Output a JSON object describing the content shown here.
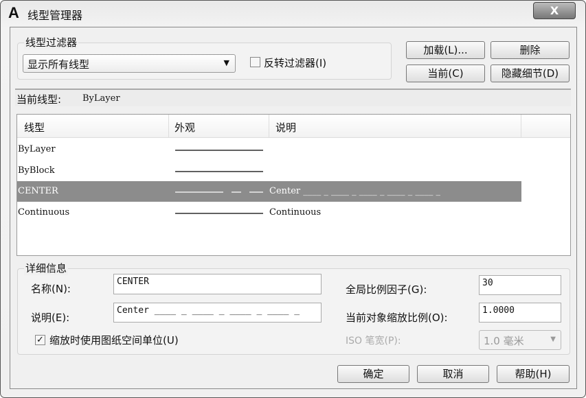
{
  "window": {
    "title": "线型管理器",
    "close_label": "X"
  },
  "filter": {
    "group_label": "线型过滤器",
    "selected": "显示所有线型",
    "invert_label": "反转过滤器(I)",
    "invert_checked": false
  },
  "buttons": {
    "load": "加载(L)...",
    "delete": "删除",
    "current": "当前(C)",
    "hide_details": "隐藏细节(D)"
  },
  "current_linetype": {
    "label": "当前线型:",
    "value": "ByLayer"
  },
  "list": {
    "columns": [
      "线型",
      "外观",
      "说明"
    ],
    "rows": [
      {
        "name": "ByLayer",
        "appearance": "solid",
        "description": "",
        "selected": false
      },
      {
        "name": "ByBlock",
        "appearance": "solid",
        "description": "",
        "selected": false
      },
      {
        "name": "CENTER",
        "appearance": "center",
        "description": "Center ____ _ ____ _ ____ _ ____ _ ____ _",
        "selected": true
      },
      {
        "name": "Continuous",
        "appearance": "solid",
        "description": "Continuous",
        "selected": false
      }
    ]
  },
  "details": {
    "group_label": "详细信息",
    "name_label": "名称(N):",
    "name_value": "CENTER",
    "desc_label": "说明(E):",
    "desc_value": "Center ____ _ ____ _ ____ _ ____ _",
    "paper_space_label": "缩放时使用图纸空间单位(U)",
    "paper_space_checked": true,
    "global_scale_label": "全局比例因子(G):",
    "global_scale_value": "30",
    "object_scale_label": "当前对象缩放比例(O):",
    "object_scale_value": "1.0000",
    "iso_pen_label": "ISO 笔宽(P):",
    "iso_pen_value": "1.0 毫米"
  },
  "footer": {
    "ok": "确定",
    "cancel": "取消",
    "help": "帮助(H)"
  }
}
